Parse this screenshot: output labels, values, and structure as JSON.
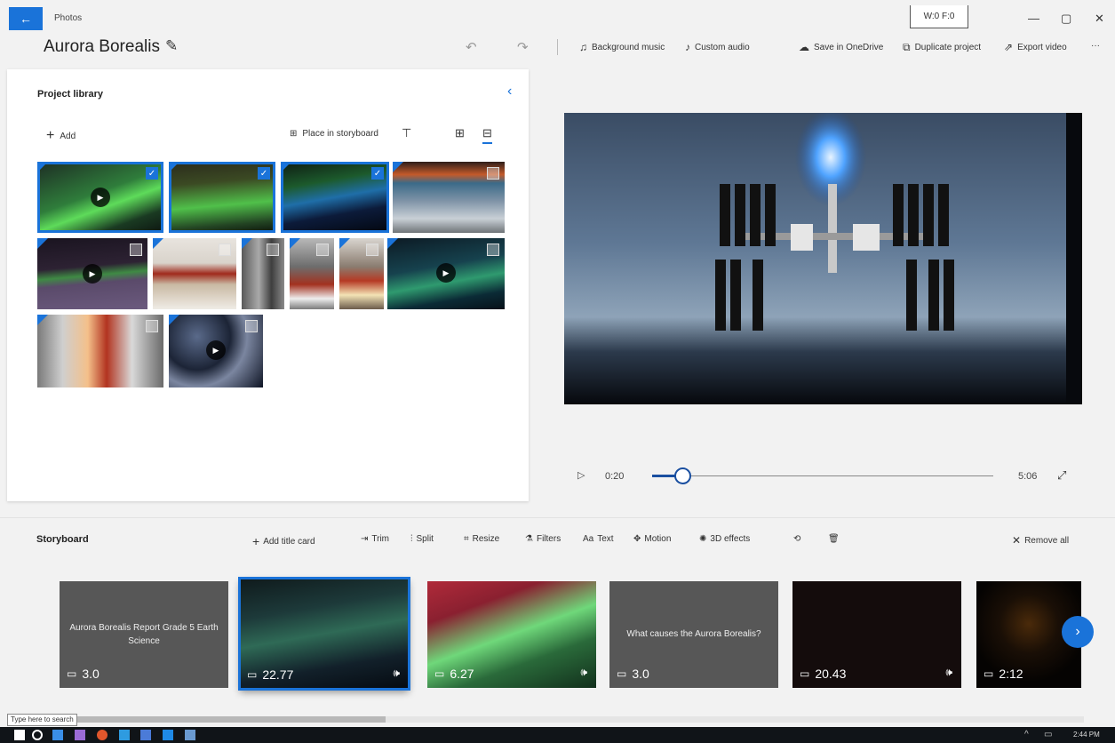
{
  "app": {
    "title": "Photos",
    "wf_label": "W:0  F:0"
  },
  "project": {
    "name": "Aurora Borealis"
  },
  "toolbar": {
    "background_music": "Background music",
    "custom_audio": "Custom audio",
    "save_onedrive": "Save in OneDrive",
    "duplicate_project": "Duplicate project",
    "export_video": "Export video",
    "more": "···"
  },
  "library": {
    "title": "Project library",
    "add_label": "Add",
    "place_label": "Place in storyboard",
    "items": [
      {
        "type": "video",
        "selected": true
      },
      {
        "type": "photo",
        "selected": true
      },
      {
        "type": "photo",
        "selected": true
      },
      {
        "type": "photo",
        "selected": false
      },
      {
        "type": "video",
        "selected": false
      },
      {
        "type": "photo",
        "selected": false
      },
      {
        "type": "photo",
        "selected": false
      },
      {
        "type": "photo",
        "selected": false
      },
      {
        "type": "photo",
        "selected": false
      },
      {
        "type": "video",
        "selected": false
      },
      {
        "type": "photo",
        "selected": false
      },
      {
        "type": "video",
        "selected": false
      }
    ]
  },
  "playback": {
    "current_time": "0:20",
    "total_time": "5:06",
    "progress_fraction": 0.065
  },
  "storyboard": {
    "title": "Storyboard",
    "tools": {
      "add_title_card": "Add title card",
      "trim": "Trim",
      "split": "Split",
      "resize": "Resize",
      "filters": "Filters",
      "text": "Text",
      "motion": "Motion",
      "effects_3d": "3D effects",
      "remove_all": "Remove all"
    },
    "clips": [
      {
        "kind": "title",
        "text": "Aurora Borealis Report Grade 5 Earth Science",
        "duration": "3.0",
        "audio": false
      },
      {
        "kind": "video",
        "text": "",
        "duration": "22.77",
        "audio": true
      },
      {
        "kind": "video",
        "text": "",
        "duration": "6.27",
        "audio": true
      },
      {
        "kind": "title",
        "text": "What causes the Aurora Borealis?",
        "duration": "3.0",
        "audio": false
      },
      {
        "kind": "video",
        "text": "",
        "duration": "20.43",
        "audio": true
      },
      {
        "kind": "video",
        "text": "",
        "duration": "2:12",
        "audio": false
      }
    ]
  },
  "taskbar": {
    "search_tooltip": "Type here to search",
    "clock": "2:44 PM"
  },
  "colors": {
    "accent": "#1a73d9",
    "background": "#f2f2f2",
    "panel": "#ffffff"
  }
}
